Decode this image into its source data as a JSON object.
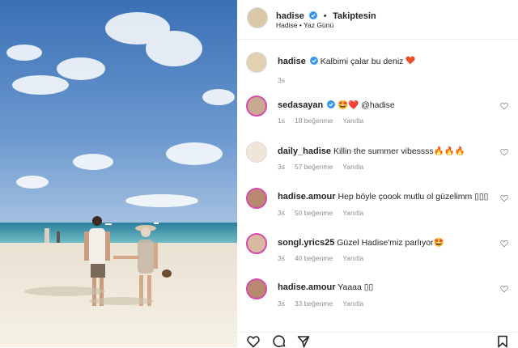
{
  "post": {
    "photo_alt": "",
    "header": {
      "username": "hadise",
      "separator": "•",
      "follow_label": "Takiptesin",
      "subtitle": "Hadise • Yaz Günü"
    },
    "caption": {
      "username": "hadise",
      "text": "Kalbimi çalar bu deniz",
      "time": "3s"
    },
    "comments": [
      {
        "username": "sedasayan",
        "text": "🤩❤️ @hadise",
        "time": "1s",
        "likes": "18 beğenme",
        "reply": "Yanıtla"
      },
      {
        "username": "daily_hadise",
        "text": "Killin the summer vibessss🔥🔥🔥",
        "time": "3s",
        "likes": "57 beğenme",
        "reply": "Yanıtla"
      },
      {
        "username": "hadise.amour",
        "text": "Hep böyle çoook mutlu ol güzelimm ▯▯▯",
        "time": "3s",
        "likes": "50 beğenme",
        "reply": "Yanıtla"
      },
      {
        "username": "songl.yrics25",
        "text": "Güzel Hadise'miz parlıyor🤩",
        "time": "3s",
        "likes": "40 beğenme",
        "reply": "Yanıtla"
      },
      {
        "username": "hadise.amour",
        "text": "Yaaaa ▯▯",
        "time": "3s",
        "likes": "33 beğenme",
        "reply": "Yanıtla"
      }
    ],
    "actions": [
      "heart-icon",
      "comment-icon",
      "share-icon",
      "bookmark-icon"
    ],
    "colors": {
      "verified": "#3897f0",
      "heart": "#ed4956",
      "text": "#262626",
      "muted": "#8e8e8e"
    }
  }
}
